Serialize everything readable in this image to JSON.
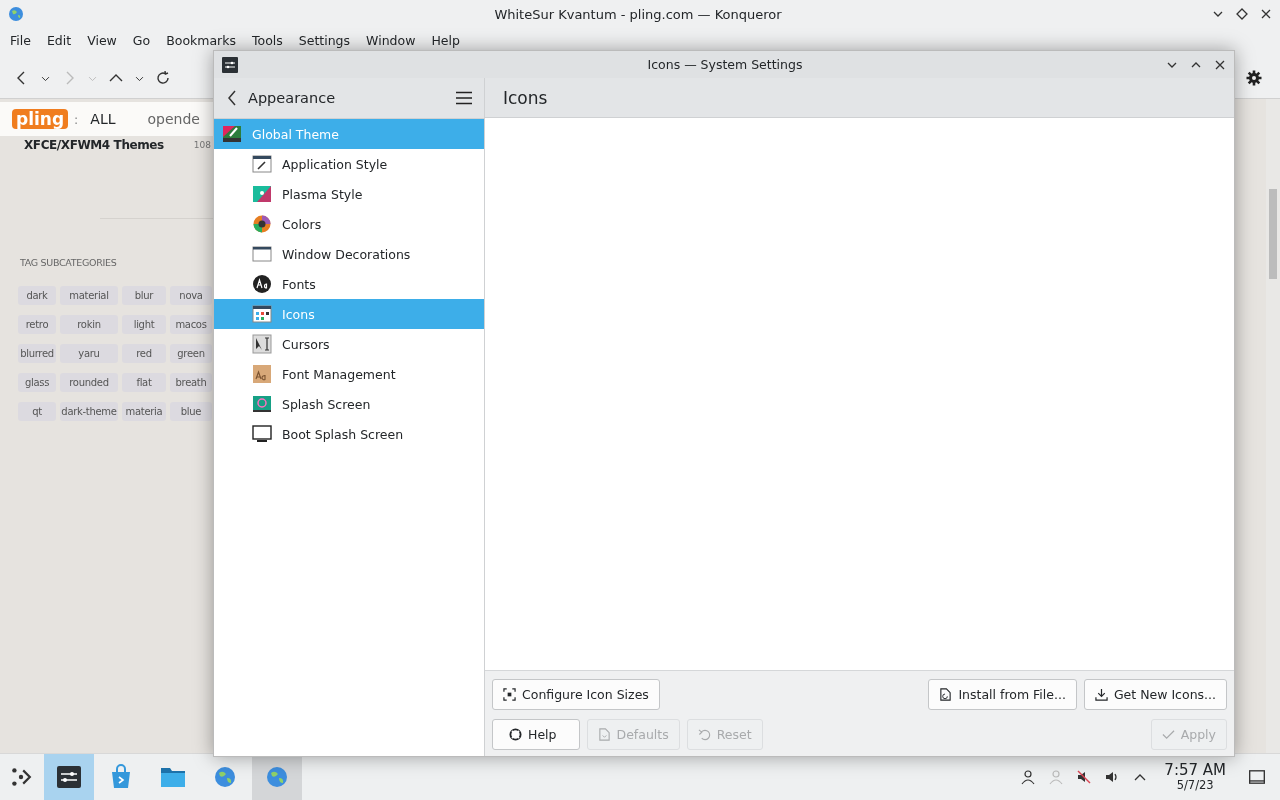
{
  "browser": {
    "title": "WhiteSur Kvantum - pling.com — Konqueror",
    "menu": [
      "File",
      "Edit",
      "View",
      "Go",
      "Bookmarks",
      "Tools",
      "Settings",
      "Window",
      "Help"
    ],
    "page": {
      "logo": "pling",
      "separator": ":",
      "scope": "ALL",
      "search_text": "opende",
      "category": "XFCE/XFWM4 Themes",
      "count": "108",
      "tag_heading": "TAG SUBCATEGORIES",
      "tags": [
        "dark",
        "material",
        "blur",
        "nova",
        "retro",
        "rokin",
        "light",
        "macos",
        "blurred",
        "yaru",
        "red",
        "green",
        "glass",
        "rounded",
        "flat",
        "breath",
        "qt",
        "dark-theme",
        "materia",
        "blue"
      ]
    }
  },
  "settings": {
    "title": "Icons — System Settings",
    "back_label": "Appearance",
    "page_title": "Icons",
    "items": [
      {
        "label": "Global Theme",
        "selected": true,
        "top": true
      },
      {
        "label": "Application Style",
        "selected": false,
        "top": false
      },
      {
        "label": "Plasma Style",
        "selected": false,
        "top": false
      },
      {
        "label": "Colors",
        "selected": false,
        "top": false
      },
      {
        "label": "Window Decorations",
        "selected": false,
        "top": false
      },
      {
        "label": "Fonts",
        "selected": false,
        "top": false
      },
      {
        "label": "Icons",
        "selected": true,
        "top": false
      },
      {
        "label": "Cursors",
        "selected": false,
        "top": false
      },
      {
        "label": "Font Management",
        "selected": false,
        "top": false
      },
      {
        "label": "Splash Screen",
        "selected": false,
        "top": false
      },
      {
        "label": "Boot Splash Screen",
        "selected": false,
        "top": false
      }
    ],
    "top_buttons": [
      {
        "label": "Configure Icon Sizes",
        "disabled": false
      },
      {
        "label": "Install from File...",
        "disabled": false
      },
      {
        "label": "Get New Icons...",
        "disabled": false
      }
    ],
    "bottom_buttons": [
      {
        "label": "Help",
        "disabled": false
      },
      {
        "label": "Defaults",
        "disabled": true
      },
      {
        "label": "Reset",
        "disabled": true
      },
      {
        "label": "Apply",
        "disabled": true
      }
    ]
  },
  "taskbar": {
    "apps": [
      {
        "selected": true
      },
      {
        "selected": false
      },
      {
        "selected": false
      },
      {
        "selected": false
      },
      {
        "selected": false
      }
    ],
    "time": "7:57 AM",
    "date": "5/7/23"
  }
}
